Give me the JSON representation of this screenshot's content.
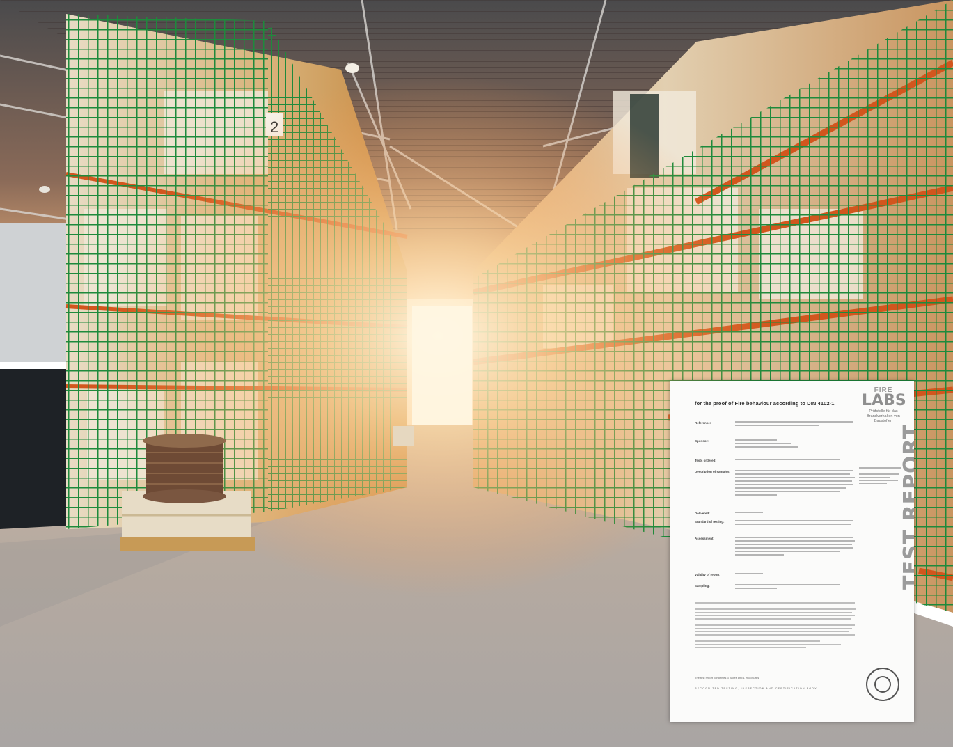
{
  "scene": {
    "description_label": "warehouse-aisle-photo",
    "colors": {
      "floor": "#b3aba2",
      "roof": "#5a4a44",
      "mesh": "#1f8c3e",
      "beam": "#d2561e",
      "light": "#fff3d6"
    },
    "aisle_sign": "2"
  },
  "report": {
    "title": "for the proof of Fire behaviour according to DIN 4102-1",
    "logo_top": "FIRE",
    "logo_big": "LABS",
    "logo_sub": "Prüfstelle für das Brandverhalten von Baustoffen",
    "side_label": "TEST REPORT",
    "footer_line": "The test report comprises 3 pages and 1 enclosures",
    "footer_band": "RECOGNIZED TESTING, INSPECTION AND CERTIFICATION BODY",
    "fields": [
      {
        "label": "Reference:"
      },
      {
        "label": "Sponsor:"
      },
      {
        "label": "Tests ordered:"
      },
      {
        "label": "Description of samples:"
      },
      {
        "label": "Delivered:"
      },
      {
        "label": "Standard of testing:"
      },
      {
        "label": "Assessment:"
      },
      {
        "label": "Validity of report:"
      },
      {
        "label": "Sampling:"
      }
    ]
  }
}
